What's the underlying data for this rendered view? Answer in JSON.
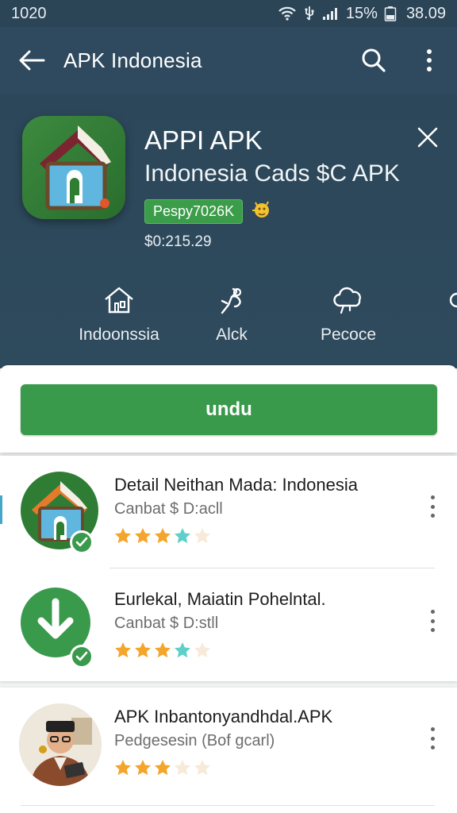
{
  "status_bar": {
    "time": "1020",
    "battery": "15%",
    "clock": "38.09"
  },
  "app_bar": {
    "title": "APK Indonesia"
  },
  "header": {
    "app_name": "APPI APK",
    "subtitle": "Indonesia Cads $C APK",
    "badge": "Pespy7026K",
    "price": "$0:215.29"
  },
  "categories": [
    {
      "label": "Indoonssia",
      "icon": "house-icon"
    },
    {
      "label": "Alck",
      "icon": "hand-icon"
    },
    {
      "label": "Pecoce",
      "icon": "cloud-icon"
    }
  ],
  "download": {
    "label": "undu"
  },
  "items": [
    {
      "name": "Detail Neithan Mada: Indonesia",
      "sub": "Canbat $ D:acll",
      "rating": 3.5,
      "icon": "house-app-icon"
    },
    {
      "name": "Eurlekal, Maiatin Pohelntal.",
      "sub": "Canbat $ D:stll",
      "rating": 3.5,
      "icon": "download-arrow-icon"
    },
    {
      "name": "APK Inbantonyandhdal.APK",
      "sub": "Pedgesesin (Bof gcarl)",
      "rating": 3,
      "icon": "avatar-photo"
    }
  ],
  "colors": {
    "accent_green": "#3a9a4c",
    "header_bg": "#2e4a5d",
    "star": "#f4a52b",
    "star_half": "#5ed0c9"
  }
}
